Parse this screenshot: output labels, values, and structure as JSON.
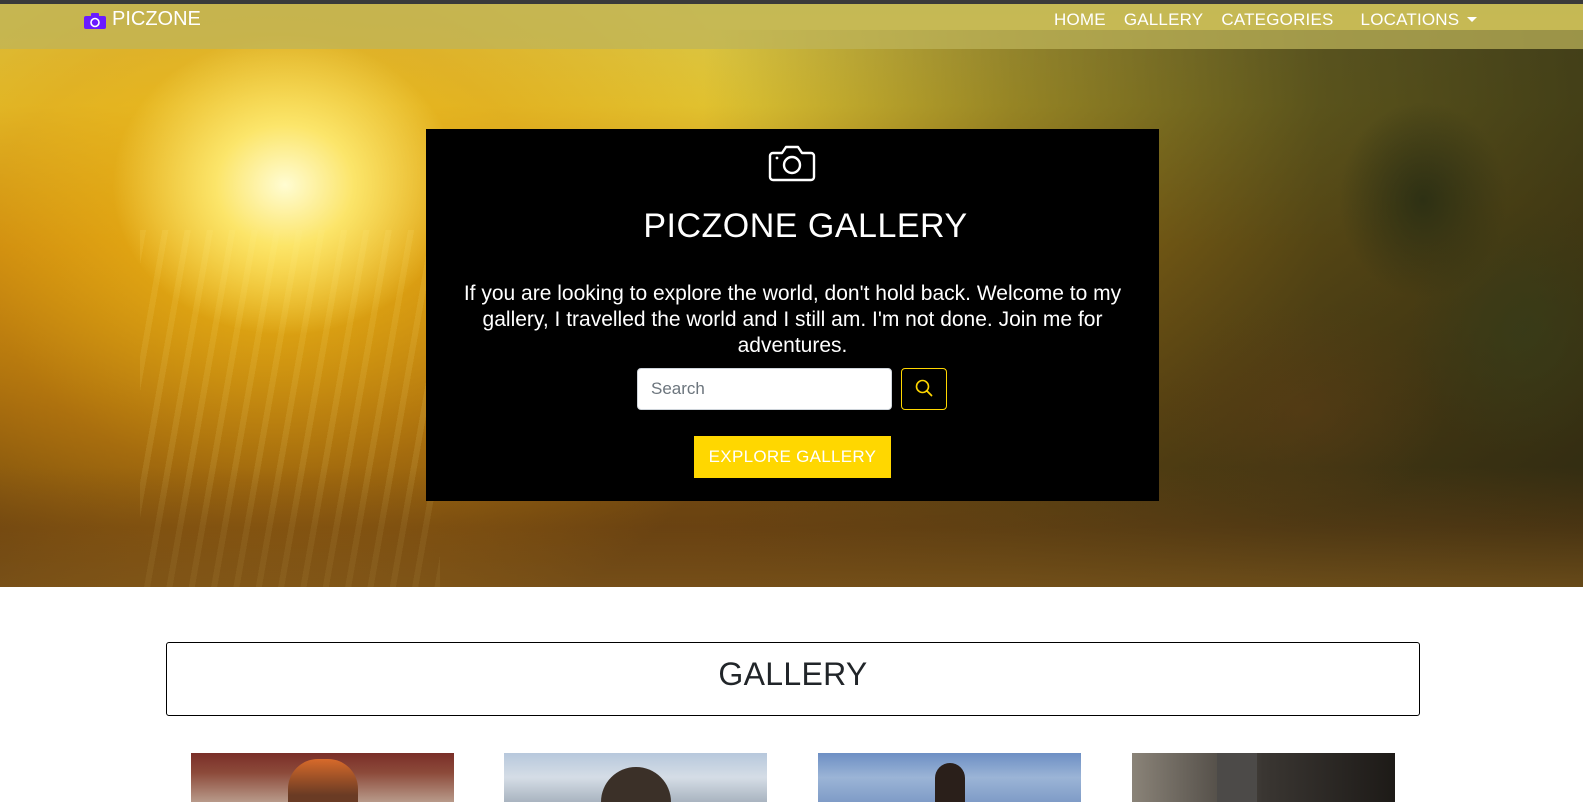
{
  "navbar": {
    "brand": "PICZONE",
    "brand_icon": "camera-icon",
    "links": [
      {
        "label": "HOME"
      },
      {
        "label": "GALLERY"
      },
      {
        "label": "CATEGORIES"
      },
      {
        "label": "LOCATIONS",
        "dropdown": true
      }
    ],
    "icon_color": "#6a1bff"
  },
  "hero": {
    "icon": "camera-icon",
    "title": "PICZONE GALLERY",
    "text": "If you are looking to explore the world, don't hold back. Welcome to my gallery, I travelled the world and I still am. I'm not done. Join me for adventures.",
    "search": {
      "placeholder": "Search",
      "value": "",
      "button_icon": "search-icon"
    },
    "cta_label": "EXPLORE GALLERY",
    "accent_color": "#ffd700"
  },
  "gallery": {
    "title": "GALLERY",
    "thumbnails": [
      {
        "alt": "portrait-1"
      },
      {
        "alt": "portrait-2"
      },
      {
        "alt": "portrait-3"
      },
      {
        "alt": "portrait-4"
      }
    ]
  }
}
